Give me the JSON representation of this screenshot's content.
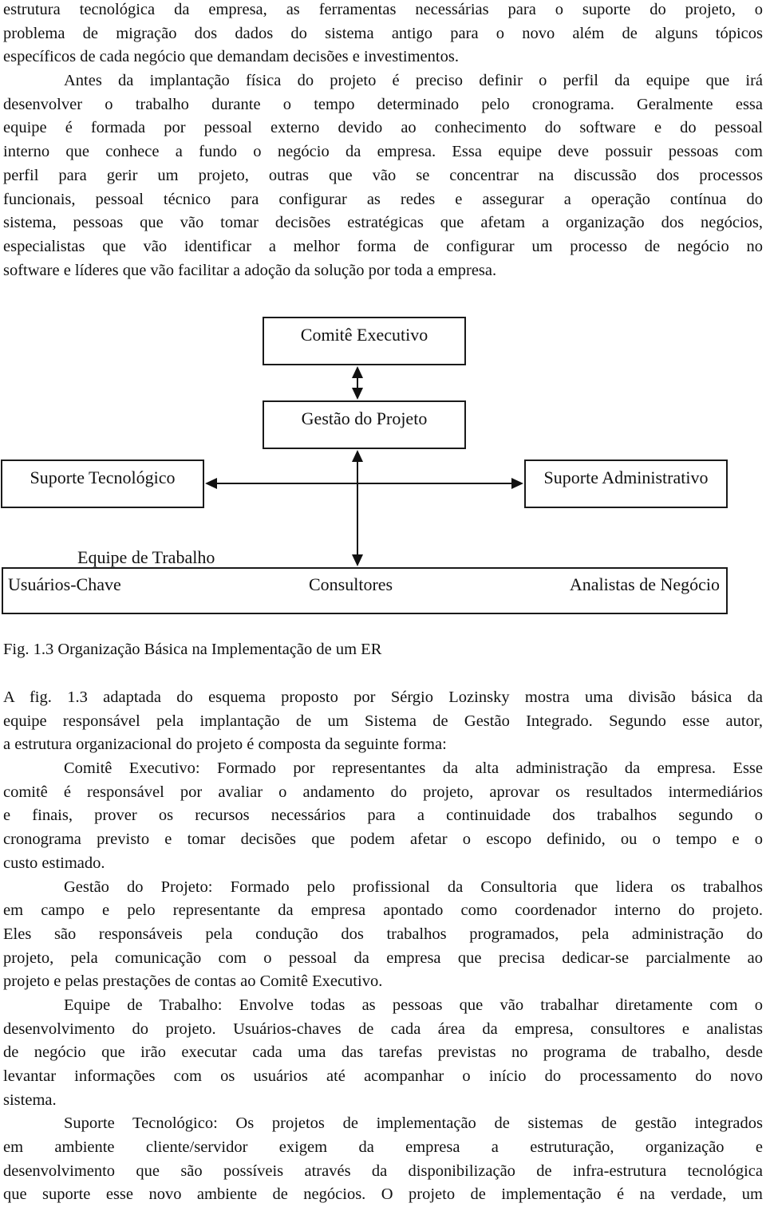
{
  "intro": {
    "lines": [
      "estrutura tecnológica da empresa, as ferramentas necessárias para o suporte do projeto, o",
      "problema de migração dos dados do sistema antigo para o novo além de alguns tópicos",
      "específicos de cada negócio  que demandam decisões e investimentos.",
      "Antes da implantação física do projeto é preciso definir o perfil da equipe que irá",
      "desenvolver o trabalho durante o tempo determinado pelo cronograma. Geralmente essa",
      "equipe é formada por pessoal externo devido ao conhecimento do software e do pessoal",
      "interno que conhece a fundo o negócio da empresa. Essa equipe deve possuir pessoas com",
      "perfil para gerir um projeto, outras que vão se concentrar na discussão dos processos",
      "funcionais, pessoal técnico para configurar as redes e assegurar a operação contínua do",
      "sistema, pessoas que vão tomar decisões estratégicas que afetam a organização dos negócios,",
      "especialistas que vão identificar a melhor forma de configurar um processo de negócio no",
      "software e líderes que vão facilitar a adoção da solução por toda a empresa."
    ]
  },
  "diagram": {
    "comite": "Comitê Executivo",
    "gestao": "Gestão do Projeto",
    "suporte_tecnologico": "Suporte Tecnológico",
    "suporte_administrativo": "Suporte Administrativo",
    "equipe_title": "Equipe de Trabalho",
    "equipe_members": [
      "Usuários-Chave",
      "Consultores",
      "Analistas de Negócio"
    ]
  },
  "caption": "Fig. 1.3  Organização Básica na Implementação de um ER",
  "body": {
    "lines": [
      "A fig. 1.3 adaptada do esquema proposto por Sérgio Lozinsky mostra uma divisão básica da",
      "equipe responsável pela implantação de um Sistema de Gestão Integrado. Segundo esse autor,",
      "a estrutura organizacional do projeto é composta da seguinte forma:",
      "Comitê Executivo: Formado por representantes da alta administração da empresa. Esse",
      "comitê é responsável por avaliar o andamento do projeto, aprovar os resultados intermediários",
      "e finais, prover os recursos necessários para a continuidade dos trabalhos segundo o",
      "cronograma previsto e tomar decisões que podem afetar o escopo definido, ou o tempo e o",
      "custo estimado.",
      "Gestão do Projeto: Formado pelo profissional da Consultoria que lidera os trabalhos",
      "em campo e pelo representante da empresa apontado como coordenador interno do projeto.",
      "Eles são responsáveis pela condução dos trabalhos programados, pela administração do",
      "projeto, pela comunicação com o pessoal da empresa que precisa dedicar-se parcialmente ao",
      "projeto e pelas prestações de contas ao Comitê Executivo.",
      "Equipe de Trabalho: Envolve todas as pessoas que vão trabalhar diretamente com o",
      "desenvolvimento do projeto. Usuários-chaves de cada área da empresa, consultores e analistas",
      "de negócio que irão executar cada uma das tarefas previstas no programa de trabalho, desde",
      "levantar informações com os usuários até acompanhar o início do processamento do novo",
      "sistema.",
      "Suporte Tecnológico: Os projetos de implementação de sistemas de gestão integrados",
      "em ambiente cliente/servidor exigem da empresa a estruturação, organização e",
      "desenvolvimento que são possíveis através da disponibilização de infra-estrutura tecnológica",
      "que suporte esse novo ambiente de negócios. O projeto de implementação é na verdade, um"
    ]
  }
}
